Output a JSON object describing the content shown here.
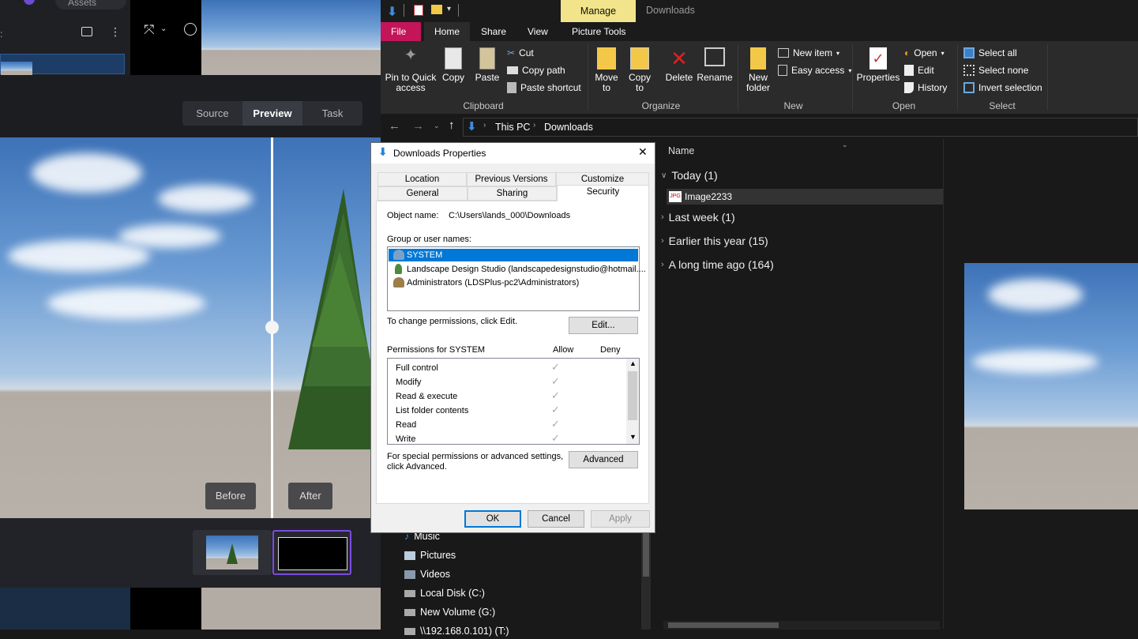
{
  "left_app": {
    "toolbar_label": "Assets",
    "view_tabs": [
      "Source",
      "Preview",
      "Task"
    ],
    "active_tab": "Preview",
    "before_label": "Before",
    "after_label": "After"
  },
  "explorer": {
    "title_tabs": {
      "manage": "Manage",
      "window_title": "Downloads"
    },
    "ribbon_tabs": [
      "File",
      "Home",
      "Share",
      "View",
      "Picture Tools"
    ],
    "clipboard": {
      "pin": "Pin to Quick access",
      "copy": "Copy",
      "paste": "Paste",
      "cut": "Cut",
      "copy_path": "Copy path",
      "paste_shortcut": "Paste shortcut",
      "group": "Clipboard"
    },
    "organize": {
      "move_to": "Move to",
      "copy_to": "Copy to",
      "delete": "Delete",
      "rename": "Rename",
      "group": "Organize"
    },
    "new": {
      "new_folder": "New folder",
      "new_item": "New item",
      "easy_access": "Easy access",
      "group": "New"
    },
    "open": {
      "properties": "Properties",
      "open": "Open",
      "edit": "Edit",
      "history": "History",
      "group": "Open"
    },
    "select": {
      "select_all": "Select all",
      "select_none": "Select none",
      "invert": "Invert selection",
      "group": "Select"
    },
    "breadcrumb": [
      "This PC",
      "Downloads"
    ],
    "column_name": "Name",
    "groups": [
      {
        "label": "Today (1)",
        "expanded": true
      },
      {
        "label": "Last week (1)",
        "expanded": false
      },
      {
        "label": "Earlier this year (15)",
        "expanded": false
      },
      {
        "label": "A long time ago (164)",
        "expanded": false
      }
    ],
    "file": {
      "badge": "JPG",
      "name": "Image2233"
    },
    "nav_items": [
      "Music",
      "Pictures",
      "Videos",
      "Local Disk (C:)",
      "New Volume (G:)",
      "\\\\192.168.0.101) (T:)"
    ]
  },
  "dialog": {
    "title": "Downloads Properties",
    "tabs_back": [
      "Location",
      "Previous Versions",
      "Customize"
    ],
    "tabs_front": [
      "General",
      "Sharing",
      "Security"
    ],
    "active_tab": "Security",
    "object_label": "Object name:",
    "object_value": "C:\\Users\\lands_000\\Downloads",
    "group_label": "Group or user names:",
    "users": [
      "SYSTEM",
      "Landscape Design Studio (landscapedesignstudio@hotmail....",
      "Administrators (LDSPlus-pc2\\Administrators)"
    ],
    "change_text": "To change permissions, click Edit.",
    "edit_button": "Edit...",
    "perm_header": "Permissions for SYSTEM",
    "allow": "Allow",
    "deny": "Deny",
    "permissions": [
      "Full control",
      "Modify",
      "Read & execute",
      "List folder contents",
      "Read",
      "Write"
    ],
    "special_text_1": "For special permissions or advanced settings,",
    "special_text_2": "click Advanced.",
    "advanced_button": "Advanced",
    "ok": "OK",
    "cancel": "Cancel",
    "apply": "Apply"
  },
  "colors": {
    "file_tab": "#c4145a",
    "manage_tab": "#f1e48b",
    "selection": "#0078d7",
    "accent_purple": "#7b4ae2"
  }
}
